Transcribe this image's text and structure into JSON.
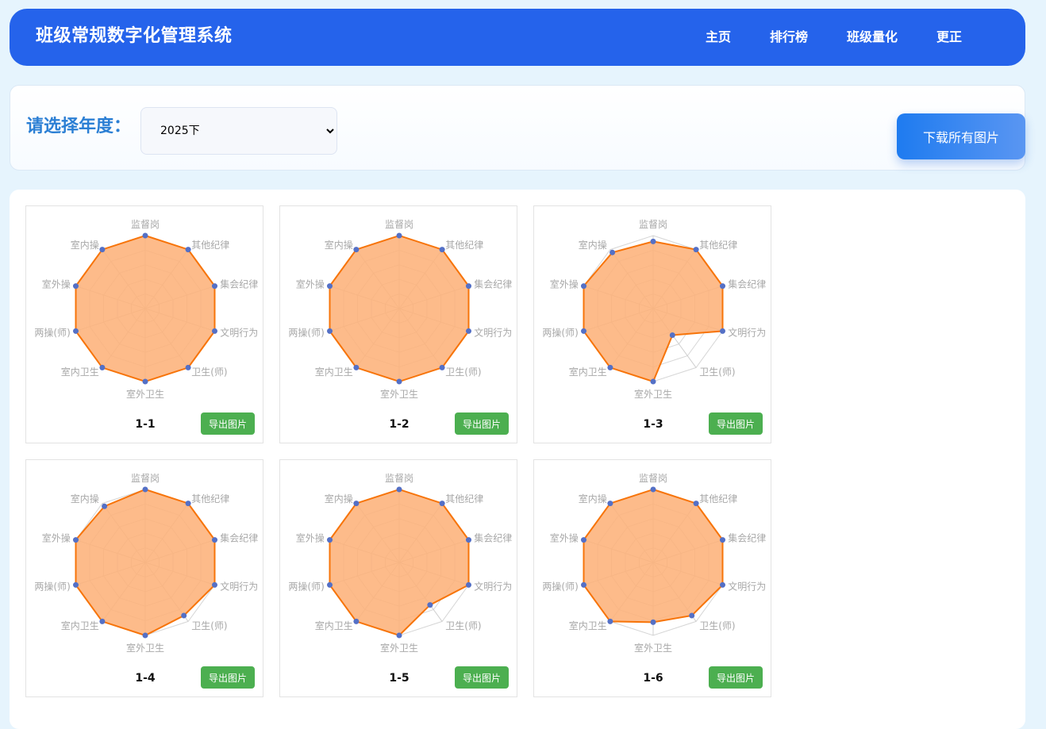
{
  "header": {
    "title": "班级常规数字化管理系统",
    "nav": [
      "主页",
      "排行榜",
      "班级量化",
      "更正"
    ]
  },
  "filter": {
    "label": "请选择年度：",
    "selected_year": "2025下",
    "download_all_label": "下载所有图片"
  },
  "export_label": "导出图片",
  "colors": {
    "header_bg": "#2563eb",
    "radar_fill": "#fdb27a",
    "radar_line": "#f77409",
    "radar_point": "#5470c6",
    "export_button": "#4caf50"
  },
  "chart_data": [
    {
      "type": "radar",
      "title": "1-1",
      "indicators": [
        "监督岗",
        "其他纪律",
        "集会纪律",
        "文明行为",
        "卫生(师)",
        "室外卫生",
        "室内卫生",
        "两操(师)",
        "室外操",
        "室内操"
      ],
      "max": 100,
      "values": [
        100,
        100,
        100,
        100,
        100,
        100,
        100,
        100,
        100,
        100
      ]
    },
    {
      "type": "radar",
      "title": "1-2",
      "indicators": [
        "监督岗",
        "其他纪律",
        "集会纪律",
        "文明行为",
        "卫生(师)",
        "室外卫生",
        "室内卫生",
        "两操(师)",
        "室外操",
        "室内操"
      ],
      "max": 100,
      "values": [
        100,
        100,
        100,
        100,
        100,
        100,
        100,
        100,
        100,
        100
      ]
    },
    {
      "type": "radar",
      "title": "1-3",
      "indicators": [
        "监督岗",
        "其他纪律",
        "集会纪律",
        "文明行为",
        "卫生(师)",
        "室外卫生",
        "室内卫生",
        "两操(师)",
        "室外操",
        "室内操"
      ],
      "max": 100,
      "values": [
        92,
        100,
        100,
        100,
        45,
        100,
        100,
        100,
        100,
        95
      ]
    },
    {
      "type": "radar",
      "title": "1-4",
      "indicators": [
        "监督岗",
        "其他纪律",
        "集会纪律",
        "文明行为",
        "卫生(师)",
        "室外卫生",
        "室内卫生",
        "两操(师)",
        "室外操",
        "室内操"
      ],
      "max": 100,
      "values": [
        100,
        100,
        100,
        100,
        90,
        100,
        100,
        100,
        100,
        95
      ]
    },
    {
      "type": "radar",
      "title": "1-5",
      "indicators": [
        "监督岗",
        "其他纪律",
        "集会纪律",
        "文明行为",
        "卫生(师)",
        "室外卫生",
        "室内卫生",
        "两操(师)",
        "室外操",
        "室内操"
      ],
      "max": 100,
      "values": [
        100,
        100,
        100,
        100,
        72,
        100,
        100,
        100,
        100,
        100
      ]
    },
    {
      "type": "radar",
      "title": "1-6",
      "indicators": [
        "监督岗",
        "其他纪律",
        "集会纪律",
        "文明行为",
        "卫生(师)",
        "室外卫生",
        "室内卫生",
        "两操(师)",
        "室外操",
        "室内操"
      ],
      "max": 100,
      "values": [
        100,
        100,
        100,
        100,
        90,
        82,
        100,
        100,
        100,
        100
      ]
    }
  ]
}
